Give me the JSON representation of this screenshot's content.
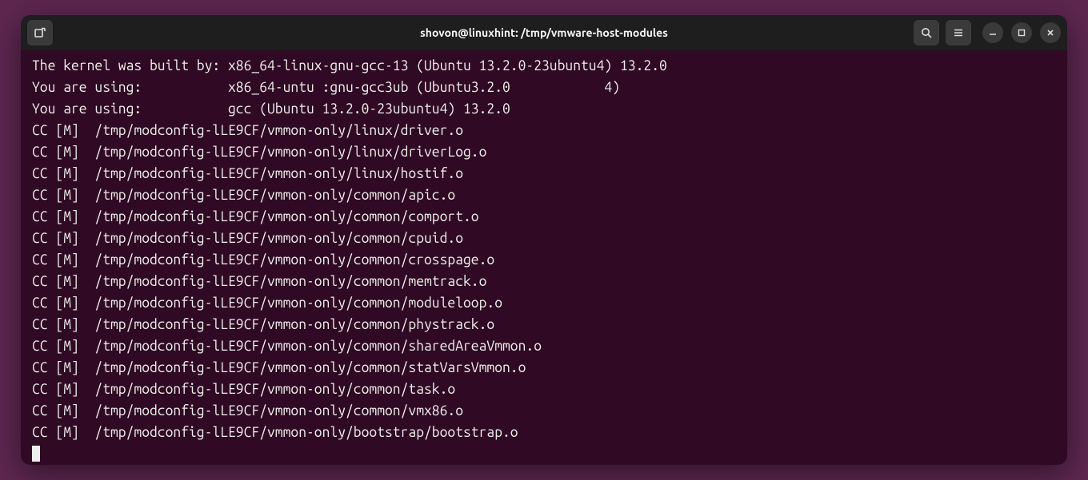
{
  "titlebar": {
    "title": "shovon@linuxhint: /tmp/vmware-host-modules"
  },
  "terminal": {
    "lines": [
      "The kernel was built by: x86_64-linux-gnu-gcc-13 (Ubuntu 13.2.0-23ubuntu4) 13.2.0",
      "You are using:           x86_64-untu :gnu-gcc3ub (Ubuntu3.2.0            4)",
      "You are using:           gcc (Ubuntu 13.2.0-23ubuntu4) 13.2.0",
      "CC [M]  /tmp/modconfig-lLE9CF/vmmon-only/linux/driver.o",
      "CC [M]  /tmp/modconfig-lLE9CF/vmmon-only/linux/driverLog.o",
      "CC [M]  /tmp/modconfig-lLE9CF/vmmon-only/linux/hostif.o",
      "CC [M]  /tmp/modconfig-lLE9CF/vmmon-only/common/apic.o",
      "CC [M]  /tmp/modconfig-lLE9CF/vmmon-only/common/comport.o",
      "CC [M]  /tmp/modconfig-lLE9CF/vmmon-only/common/cpuid.o",
      "CC [M]  /tmp/modconfig-lLE9CF/vmmon-only/common/crosspage.o",
      "CC [M]  /tmp/modconfig-lLE9CF/vmmon-only/common/memtrack.o",
      "CC [M]  /tmp/modconfig-lLE9CF/vmmon-only/common/moduleloop.o",
      "CC [M]  /tmp/modconfig-lLE9CF/vmmon-only/common/phystrack.o",
      "CC [M]  /tmp/modconfig-lLE9CF/vmmon-only/common/sharedAreaVmmon.o",
      "CC [M]  /tmp/modconfig-lLE9CF/vmmon-only/common/statVarsVmmon.o",
      "CC [M]  /tmp/modconfig-lLE9CF/vmmon-only/common/task.o",
      "CC [M]  /tmp/modconfig-lLE9CF/vmmon-only/common/vmx86.o",
      "CC [M]  /tmp/modconfig-lLE9CF/vmmon-only/bootstrap/bootstrap.o"
    ]
  }
}
